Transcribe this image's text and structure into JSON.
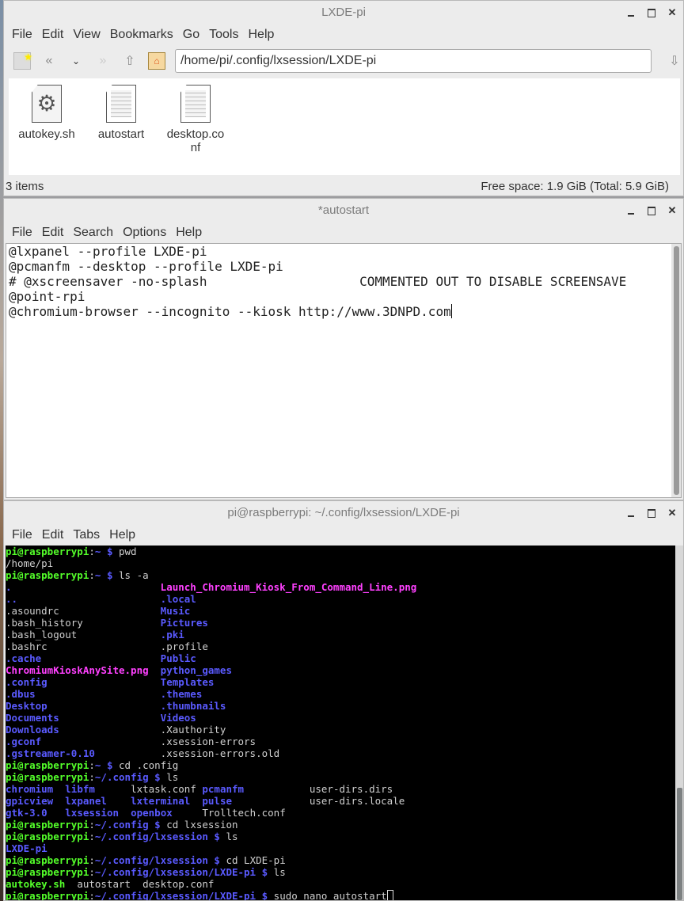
{
  "file_manager": {
    "title": "LXDE-pi",
    "menu": [
      "File",
      "Edit",
      "View",
      "Bookmarks",
      "Go",
      "Tools",
      "Help"
    ],
    "toolbar_icons": [
      "bookmark-icon",
      "back-icon",
      "history-dropdown-icon",
      "forward-icon",
      "up-icon",
      "home-icon",
      "go-icon"
    ],
    "path": "/home/pi/.config/lxsession/LXDE-pi",
    "files": [
      {
        "name": "autokey.sh",
        "icon": "script-gear-icon"
      },
      {
        "name": "autostart",
        "icon": "text-file-icon"
      },
      {
        "name": "desktop.conf",
        "icon": "text-file-icon"
      }
    ],
    "status_left": "3 items",
    "status_right": "Free space: 1.9 GiB (Total: 5.9 GiB)"
  },
  "editor": {
    "title": "*autostart",
    "menu": [
      "File",
      "Edit",
      "Search",
      "Options",
      "Help"
    ],
    "lines": [
      "@lxpanel --profile LXDE-pi",
      "@pcmanfm --desktop --profile LXDE-pi",
      "# @xscreensaver -no-splash                    COMMENTED OUT TO DISABLE SCREENSAVE",
      "@point-rpi",
      "@chromium-browser --incognito --kiosk http://www.3DNPD.com"
    ]
  },
  "terminal": {
    "title": "pi@raspberrypi: ~/.config/lxsession/LXDE-pi",
    "menu": [
      "File",
      "Edit",
      "Tabs",
      "Help"
    ],
    "prompt_user": "pi@raspberrypi",
    "lines": [
      {
        "type": "prompt",
        "path": "~",
        "cmd": "pwd"
      },
      {
        "type": "out",
        "cols": [
          {
            "t": "/home/pi",
            "c": ""
          }
        ]
      },
      {
        "type": "prompt",
        "path": "~",
        "cmd": "ls -a"
      },
      {
        "type": "out",
        "cols": [
          {
            "t": ".",
            "c": "dir",
            "w": 26
          },
          {
            "t": "Launch_Chromium_Kiosk_From_Command_Line.png",
            "c": "img"
          }
        ]
      },
      {
        "type": "out",
        "cols": [
          {
            "t": "..",
            "c": "dir",
            "w": 26
          },
          {
            "t": ".local",
            "c": "dir"
          }
        ]
      },
      {
        "type": "out",
        "cols": [
          {
            "t": ".asoundrc",
            "c": "",
            "w": 26
          },
          {
            "t": "Music",
            "c": "dir"
          }
        ]
      },
      {
        "type": "out",
        "cols": [
          {
            "t": ".bash_history",
            "c": "",
            "w": 26
          },
          {
            "t": "Pictures",
            "c": "dir"
          }
        ]
      },
      {
        "type": "out",
        "cols": [
          {
            "t": ".bash_logout",
            "c": "",
            "w": 26
          },
          {
            "t": ".pki",
            "c": "dir"
          }
        ]
      },
      {
        "type": "out",
        "cols": [
          {
            "t": ".bashrc",
            "c": "",
            "w": 26
          },
          {
            "t": ".profile",
            "c": ""
          }
        ]
      },
      {
        "type": "out",
        "cols": [
          {
            "t": ".cache",
            "c": "dir",
            "w": 26
          },
          {
            "t": "Public",
            "c": "dir"
          }
        ]
      },
      {
        "type": "out",
        "cols": [
          {
            "t": "ChromiumKioskAnySite.png",
            "c": "img",
            "w": 26
          },
          {
            "t": "python_games",
            "c": "dir"
          }
        ]
      },
      {
        "type": "out",
        "cols": [
          {
            "t": ".config",
            "c": "dir",
            "w": 26
          },
          {
            "t": "Templates",
            "c": "dir"
          }
        ]
      },
      {
        "type": "out",
        "cols": [
          {
            "t": ".dbus",
            "c": "dir",
            "w": 26
          },
          {
            "t": ".themes",
            "c": "dir"
          }
        ]
      },
      {
        "type": "out",
        "cols": [
          {
            "t": "Desktop",
            "c": "dir",
            "w": 26
          },
          {
            "t": ".thumbnails",
            "c": "dir"
          }
        ]
      },
      {
        "type": "out",
        "cols": [
          {
            "t": "Documents",
            "c": "dir",
            "w": 26
          },
          {
            "t": "Videos",
            "c": "dir"
          }
        ]
      },
      {
        "type": "out",
        "cols": [
          {
            "t": "Downloads",
            "c": "dir",
            "w": 26
          },
          {
            "t": ".Xauthority",
            "c": ""
          }
        ]
      },
      {
        "type": "out",
        "cols": [
          {
            "t": ".gconf",
            "c": "dir",
            "w": 26
          },
          {
            "t": ".xsession-errors",
            "c": ""
          }
        ]
      },
      {
        "type": "out",
        "cols": [
          {
            "t": ".gstreamer-0.10",
            "c": "dir",
            "w": 26
          },
          {
            "t": ".xsession-errors.old",
            "c": ""
          }
        ]
      },
      {
        "type": "prompt",
        "path": "~",
        "cmd": "cd .config"
      },
      {
        "type": "prompt",
        "path": "~/.config",
        "cmd": "ls"
      },
      {
        "type": "out",
        "cols": [
          {
            "t": "chromium",
            "c": "dir",
            "w": 10
          },
          {
            "t": "libfm",
            "c": "dir",
            "w": 11
          },
          {
            "t": "lxtask.conf",
            "c": "",
            "w": 12
          },
          {
            "t": "pcmanfm",
            "c": "dir",
            "w": 18
          },
          {
            "t": "user-dirs.dirs",
            "c": ""
          }
        ]
      },
      {
        "type": "out",
        "cols": [
          {
            "t": "gpicview",
            "c": "dir",
            "w": 10
          },
          {
            "t": "lxpanel",
            "c": "dir",
            "w": 11
          },
          {
            "t": "lxterminal",
            "c": "dir",
            "w": 12
          },
          {
            "t": "pulse",
            "c": "dir",
            "w": 18
          },
          {
            "t": "user-dirs.locale",
            "c": ""
          }
        ]
      },
      {
        "type": "out",
        "cols": [
          {
            "t": "gtk-3.0",
            "c": "dir",
            "w": 10
          },
          {
            "t": "lxsession",
            "c": "dir",
            "w": 11
          },
          {
            "t": "openbox",
            "c": "dir",
            "w": 12
          },
          {
            "t": "Trolltech.conf",
            "c": ""
          }
        ]
      },
      {
        "type": "prompt",
        "path": "~/.config",
        "cmd": "cd lxsession"
      },
      {
        "type": "prompt",
        "path": "~/.config/lxsession",
        "cmd": "ls"
      },
      {
        "type": "out",
        "cols": [
          {
            "t": "LXDE-pi",
            "c": "dir"
          }
        ]
      },
      {
        "type": "prompt",
        "path": "~/.config/lxsession",
        "cmd": "cd LXDE-pi"
      },
      {
        "type": "prompt",
        "path": "~/.config/lxsession/LXDE-pi",
        "cmd": "ls"
      },
      {
        "type": "out",
        "cols": [
          {
            "t": "autokey.sh",
            "c": "exe",
            "w": 12
          },
          {
            "t": "autostart",
            "c": "",
            "w": 11
          },
          {
            "t": "desktop.conf",
            "c": ""
          }
        ]
      },
      {
        "type": "prompt",
        "path": "~/.config/lxsession/LXDE-pi",
        "cmd": "sudo nano autostart",
        "caret": true
      }
    ]
  }
}
